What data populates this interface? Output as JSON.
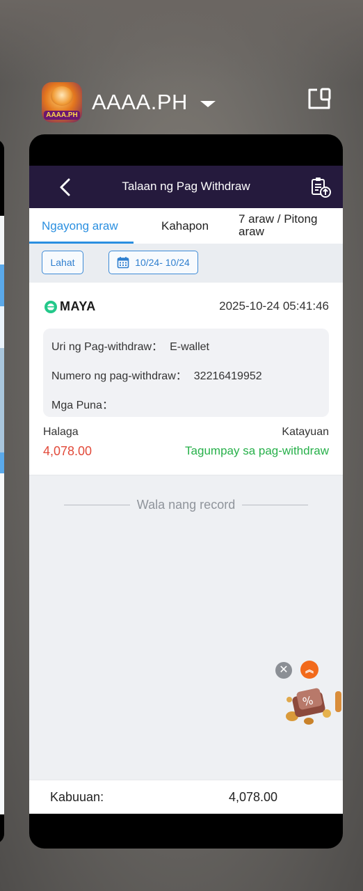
{
  "app": {
    "name": "AAAA.PH",
    "icon_label": "AAAA.PH"
  },
  "screen": {
    "title": "Talaan ng Pag Withdraw",
    "tabs": [
      "Ngayong araw",
      "Kahapon",
      "7 araw / Pitong araw"
    ],
    "active_tab": 0,
    "filters": {
      "all_label": "Lahat",
      "date_range": "10/24- 10/24"
    }
  },
  "record": {
    "method": "MAYA",
    "datetime": "2025-10-24 05:41:46",
    "type_label": "Uri ng Pag-withdraw：",
    "type_value": "E-wallet",
    "number_label": "Numero ng pag-withdraw：",
    "number_value": "32216419952",
    "remarks_label": "Mga Puna：",
    "remarks_value": "",
    "amount_label": "Halaga",
    "amount_value": "4,078.00",
    "status_label": "Katayuan",
    "status_value": "Tagumpay sa pag-withdraw"
  },
  "no_record_text": "Wala nang record",
  "footer": {
    "total_label": "Kabuuan:",
    "total_value": "4,078.00"
  },
  "colors": {
    "topbar": "#251a3d",
    "accent_blue": "#2a8fe0",
    "amount_red": "#e24a3a",
    "success_green": "#27b04a"
  },
  "icons": {
    "back": "chevron-left-icon",
    "history_doc": "document-upload-icon",
    "calendar": "calendar-icon",
    "split_screen": "split-screen-icon",
    "close": "close-icon",
    "up": "double-chevron-up-icon"
  }
}
